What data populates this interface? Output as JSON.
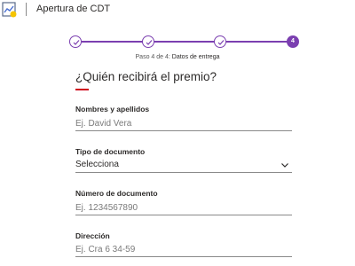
{
  "header": {
    "logo_icon": "chart-document-icon",
    "title": "Apertura de CDT"
  },
  "stepper": {
    "steps": [
      {
        "state": "done",
        "icon": "check-icon"
      },
      {
        "state": "done",
        "icon": "check-icon"
      },
      {
        "state": "done",
        "icon": "check-icon"
      },
      {
        "state": "current",
        "number": "4"
      }
    ],
    "caption_prefix": "Paso 4 de 4:",
    "caption_step": "Datos de entrega",
    "accent_color": "#7b3fb0"
  },
  "form": {
    "question": "¿Quién recibirá el premio?",
    "accent_color": "#d0021b",
    "fields": {
      "name": {
        "label": "Nombres y apellidos",
        "placeholder": "Ej. David Vera"
      },
      "doc_type": {
        "label": "Tipo de documento",
        "value": "Selecciona",
        "icon": "chevron-down-icon"
      },
      "doc_number": {
        "label": "Número de documento",
        "placeholder": "Ej. 1234567890"
      },
      "address": {
        "label": "Dirección",
        "placeholder": "Ej. Cra 6 34-59"
      }
    }
  }
}
